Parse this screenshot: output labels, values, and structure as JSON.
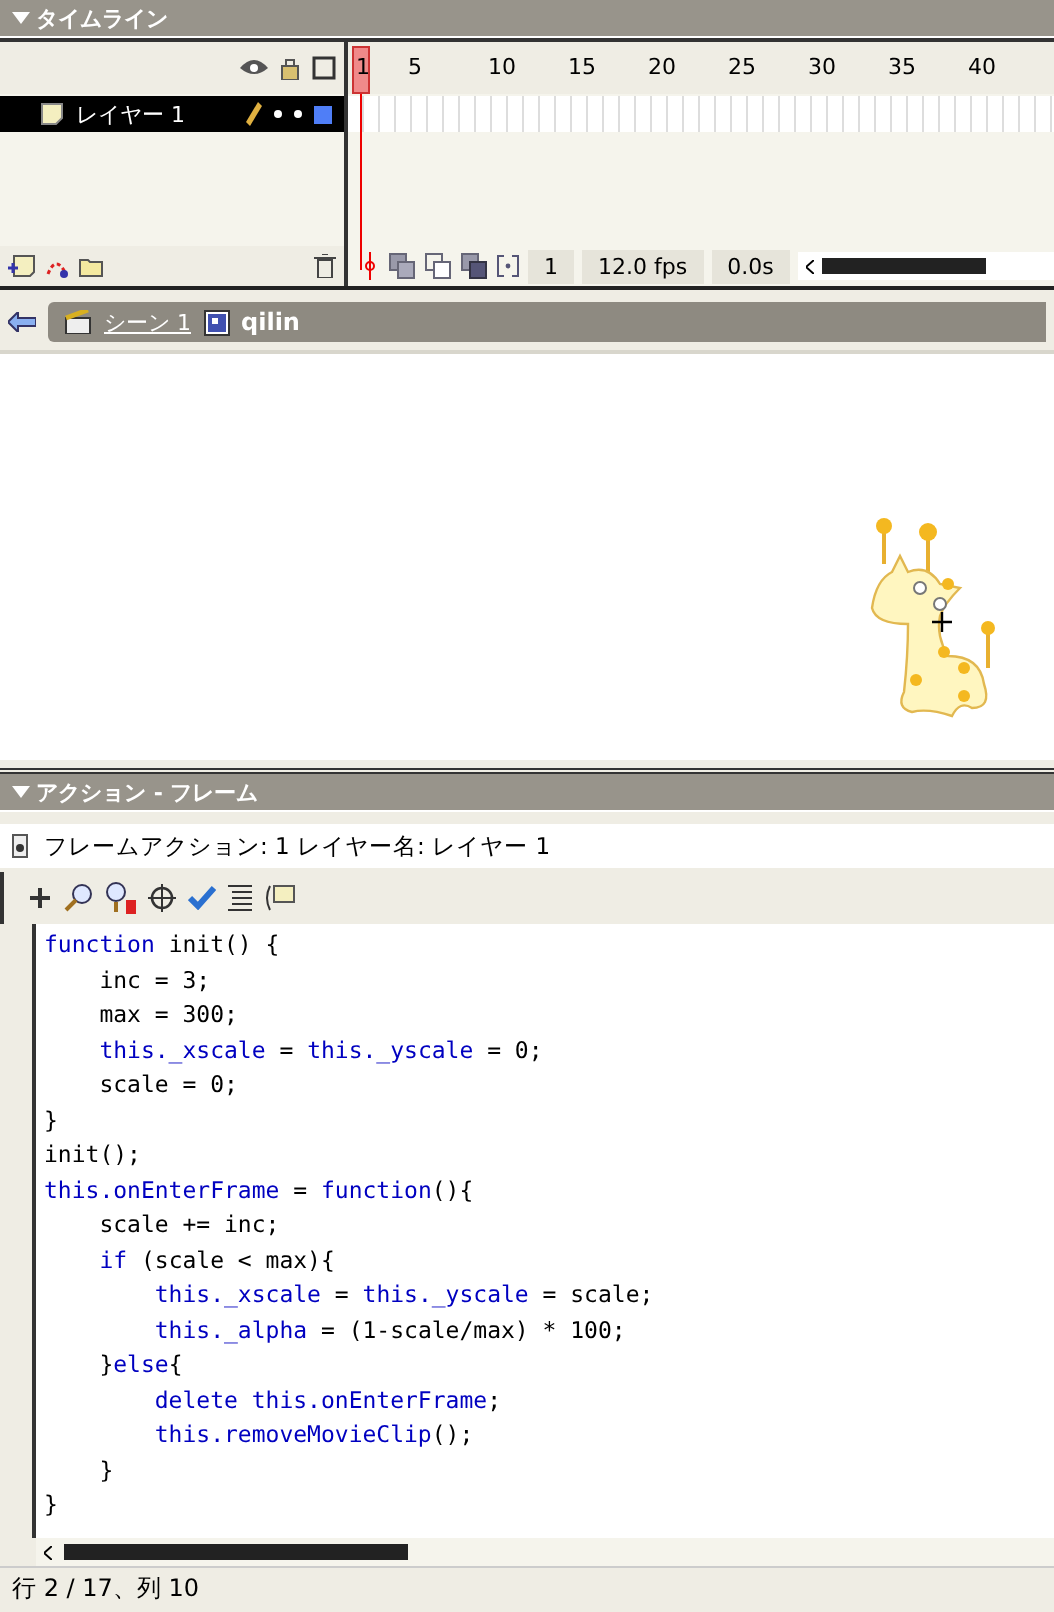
{
  "timeline": {
    "title": "タイムライン",
    "frame_numbers": [
      "1",
      "5",
      "10",
      "15",
      "20",
      "25",
      "30",
      "35",
      "40"
    ],
    "layers": [
      {
        "name": "レイヤー 1",
        "selected": true,
        "color": "#4f7ef7"
      }
    ],
    "current_frame": "1",
    "frame_rate": "12.0 fps",
    "elapsed": "0.0s"
  },
  "breadcrumb": {
    "scene": "シーン 1",
    "symbol": "qilin"
  },
  "actions": {
    "title": "アクション - フレーム",
    "info": "フレームアクション: 1 レイヤー名:  レイヤー 1",
    "code": [
      [
        {
          "kind": "keyword",
          "text": "function"
        },
        {
          "kind": "plain",
          "text": " init() {"
        }
      ],
      [
        {
          "kind": "plain",
          "text": "    inc = 3;"
        }
      ],
      [
        {
          "kind": "plain",
          "text": "    max = 300;"
        }
      ],
      [
        {
          "kind": "keyword",
          "text": "    this._xscale"
        },
        {
          "kind": "plain",
          "text": " = "
        },
        {
          "kind": "keyword",
          "text": "this._yscale"
        },
        {
          "kind": "plain",
          "text": " = 0;"
        }
      ],
      [
        {
          "kind": "plain",
          "text": "    scale = 0;"
        }
      ],
      [
        {
          "kind": "plain",
          "text": "}"
        }
      ],
      [
        {
          "kind": "plain",
          "text": "init();"
        }
      ],
      [
        {
          "kind": "keyword",
          "text": "this.onEnterFrame"
        },
        {
          "kind": "plain",
          "text": " = "
        },
        {
          "kind": "keyword",
          "text": "function"
        },
        {
          "kind": "plain",
          "text": "(){"
        }
      ],
      [
        {
          "kind": "plain",
          "text": "    scale += inc;"
        }
      ],
      [
        {
          "kind": "keyword",
          "text": "    if"
        },
        {
          "kind": "plain",
          "text": " (scale < max){"
        }
      ],
      [
        {
          "kind": "keyword",
          "text": "        this._xscale"
        },
        {
          "kind": "plain",
          "text": " = "
        },
        {
          "kind": "keyword",
          "text": "this._yscale"
        },
        {
          "kind": "plain",
          "text": " = scale;"
        }
      ],
      [
        {
          "kind": "keyword",
          "text": "        this._alpha"
        },
        {
          "kind": "plain",
          "text": " = (1-scale/max) * 100;"
        }
      ],
      [
        {
          "kind": "plain",
          "text": "    }"
        },
        {
          "kind": "keyword",
          "text": "else"
        },
        {
          "kind": "plain",
          "text": "{"
        }
      ],
      [
        {
          "kind": "keyword",
          "text": "        delete this.onEnterFrame"
        },
        {
          "kind": "plain",
          "text": ";"
        }
      ],
      [
        {
          "kind": "keyword",
          "text": "        this.removeMovieClip"
        },
        {
          "kind": "plain",
          "text": "();"
        }
      ],
      [
        {
          "kind": "plain",
          "text": "    }"
        }
      ],
      [
        {
          "kind": "plain",
          "text": "}"
        }
      ]
    ],
    "status": "行 2 / 17、列 10"
  }
}
